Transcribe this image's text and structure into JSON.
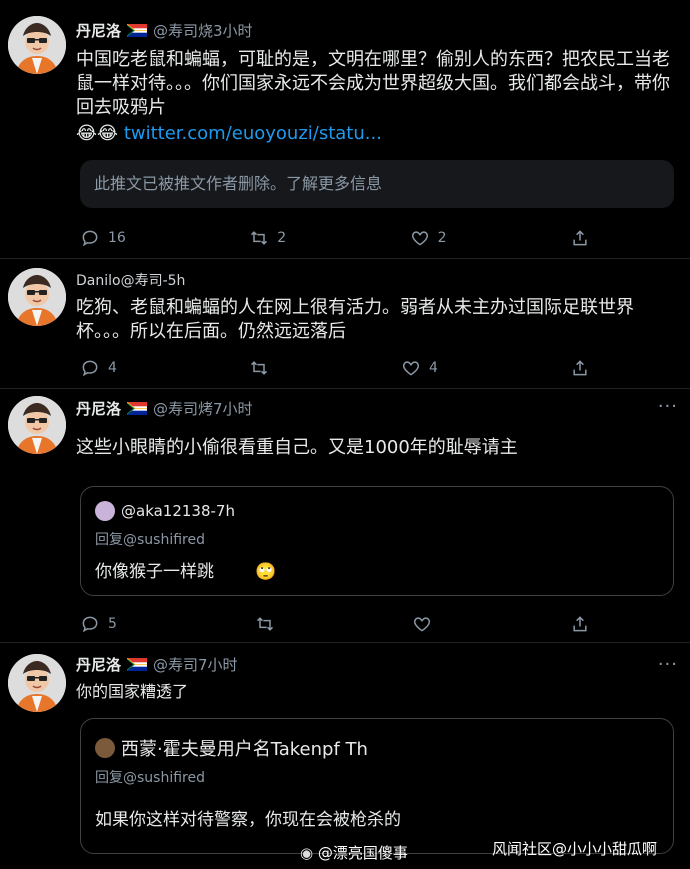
{
  "tweets": [
    {
      "name": "丹尼洛",
      "handle": "@寿司烧3小时",
      "text": "中国吃老鼠和蝙蝠，可耻的是，文明在哪里？偷别人的东西？把农民工当老鼠一样对待。。。你们国家永远不会成为世界超级大国。我们都会战斗，带你回去吸鸦片",
      "emoji": "😂😂",
      "link": "twitter.com/euoyouzi/statu...",
      "deleted_notice": "此推文已被推文作者删除。了解更多信息",
      "replies": "16",
      "retweets": "2",
      "likes": "2"
    },
    {
      "handle": "Danilo@寿司-5h",
      "text": "吃狗、老鼠和蝙蝠的人在网上很有活力。弱者从未主办过国际足联世界杯。。。所以在后面。仍然远远落后",
      "replies": "4",
      "likes": "4"
    },
    {
      "name": "丹尼洛",
      "handle": "@寿司烤7小时",
      "text": "这些小眼睛的小偷很看重自己。又是1000年的耻辱请主",
      "quote": {
        "author": "@aka12138-7h",
        "reply_to": "回复@sushifired",
        "text": "你像猴子一样跳"
      },
      "replies": "5"
    },
    {
      "name": "丹尼洛",
      "handle": "@寿司7小时",
      "text": "你的国家糟透了",
      "quote": {
        "author": "西蒙·霍夫曼用户名Takenpf Th",
        "reply_to": "回复@sushifired",
        "text": "如果你这样对待警察，你现在会被枪杀的"
      }
    }
  ],
  "watermarks": {
    "weibo": "@漂亮国傻事",
    "community": "风闻社区@小小小甜瓜啊"
  },
  "colors": {
    "background": "#000000",
    "link": "#1d9bf0",
    "muted": "#8b98a5"
  }
}
